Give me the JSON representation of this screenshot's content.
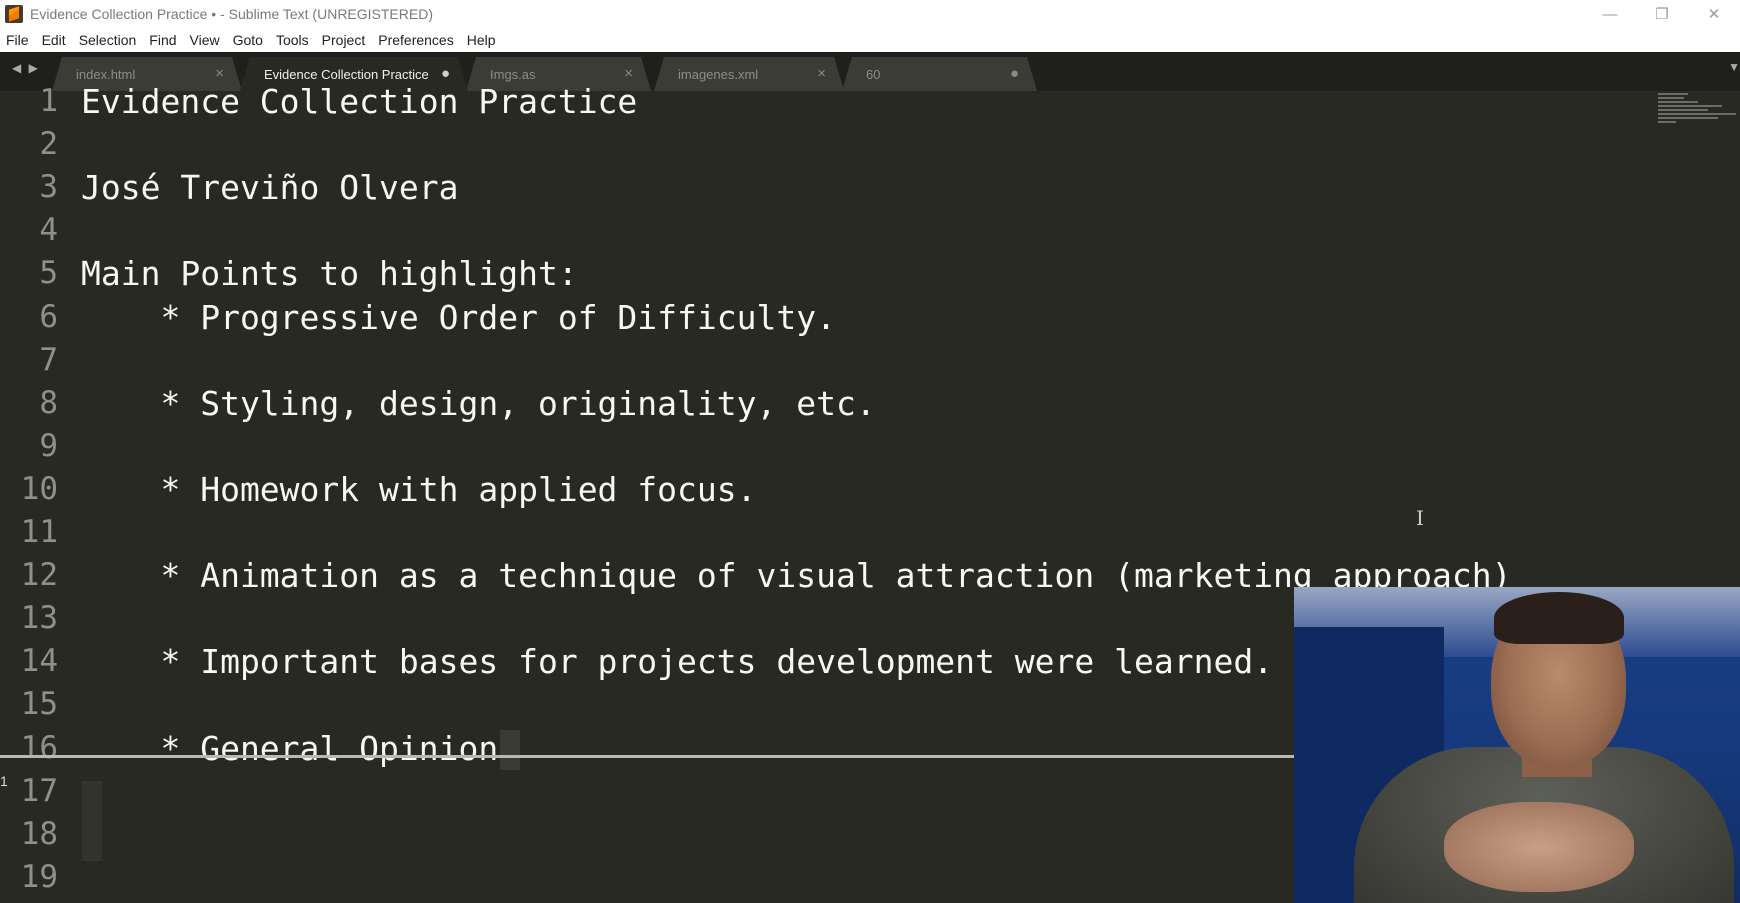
{
  "window": {
    "title": "Evidence Collection Practice • - Sublime Text (UNREGISTERED)",
    "controls": {
      "minimize": "—",
      "restore": "❐",
      "close": "✕"
    }
  },
  "menu": [
    "File",
    "Edit",
    "Selection",
    "Find",
    "View",
    "Goto",
    "Tools",
    "Project",
    "Preferences",
    "Help"
  ],
  "tabs": [
    {
      "label": "index.html",
      "control": "×",
      "active": false
    },
    {
      "label": "Evidence Collection Practice",
      "control": "●",
      "active": true
    },
    {
      "label": "Imgs.as",
      "control": "×",
      "active": false
    },
    {
      "label": "imagenes.xml",
      "control": "×",
      "active": false
    },
    {
      "label": "60",
      "control": "●",
      "active": false
    }
  ],
  "nav": {
    "arrows": "◀ ▶",
    "dropdown": "▼"
  },
  "editor": {
    "line_numbers": [
      "1",
      "2",
      "3",
      "4",
      "5",
      "6",
      "7",
      "8",
      "9",
      "10",
      "11",
      "12",
      "13",
      "14",
      "15",
      "16",
      "17",
      "18",
      "19"
    ],
    "lines": [
      "Evidence Collection Practice",
      "",
      "José Treviño Olvera",
      "",
      "Main Points to highlight:",
      "    * Progressive Order of Difficulty.",
      "",
      "    * Styling, design, originality, etc.",
      "",
      "    * Homework with applied focus.",
      "",
      "    * Animation as a technique of visual attraction (marketing approach)",
      "",
      "    * Important bases for projects development were learned.",
      "",
      "    * General Opinion",
      "",
      "",
      ""
    ]
  },
  "status": {
    "left_char": "1"
  },
  "cursor_glyph": "I"
}
